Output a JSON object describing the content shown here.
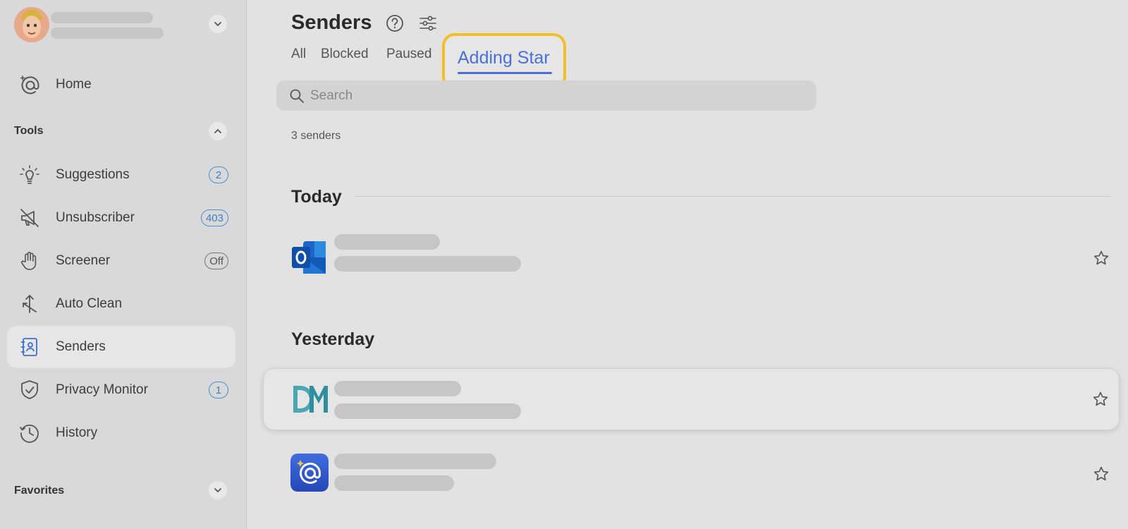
{
  "sidebar": {
    "home_label": "Home",
    "tools_label": "Tools",
    "items": [
      {
        "label": "Suggestions",
        "badge": "2"
      },
      {
        "label": "Unsubscriber",
        "badge": "403"
      },
      {
        "label": "Screener",
        "badge": "Off"
      },
      {
        "label": "Auto Clean",
        "badge": ""
      },
      {
        "label": "Senders",
        "badge": ""
      },
      {
        "label": "Privacy Monitor",
        "badge": "1"
      },
      {
        "label": "History",
        "badge": ""
      }
    ],
    "favorites_label": "Favorites"
  },
  "main": {
    "title": "Senders",
    "tabs": [
      "All",
      "Blocked",
      "Paused",
      "Adding Star"
    ],
    "active_tab": "Adding Star",
    "search_placeholder": "Search",
    "count": "3 senders",
    "groups": {
      "today": "Today",
      "yesterday": "Yesterday"
    }
  },
  "colors": {
    "accent": "#4a6fd8",
    "highlight": "#f3bf28",
    "badge": "#3b7fcb"
  },
  "icons": {
    "home": "at-sign-icon",
    "suggestions": "lightbulb-icon",
    "unsubscriber": "muted-megaphone-icon",
    "screener": "hand-icon",
    "auto_clean": "arrows-icon",
    "senders": "contacts-book-icon",
    "privacy": "shield-check-icon",
    "history": "clock-icon"
  }
}
